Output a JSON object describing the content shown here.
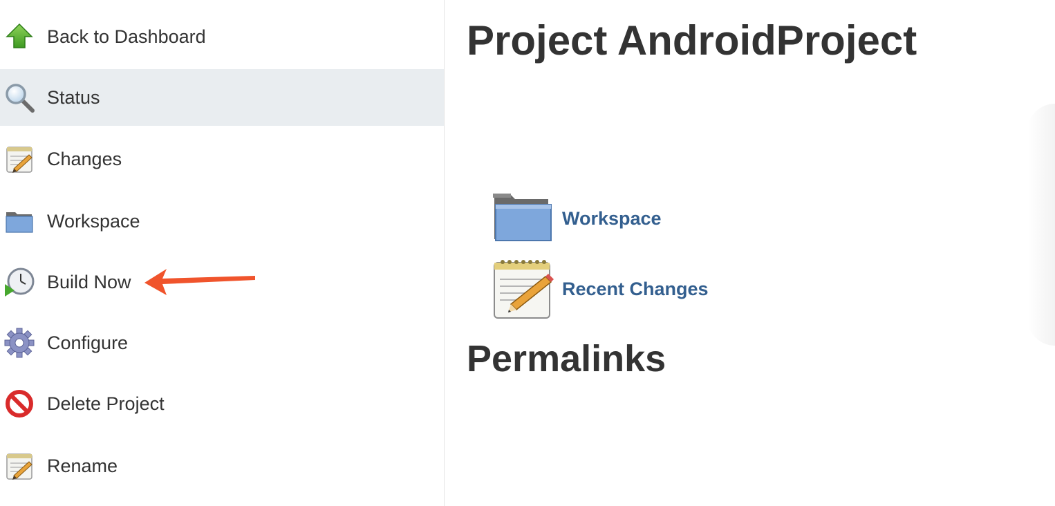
{
  "sidebar": {
    "items": [
      {
        "label": "Back to Dashboard",
        "icon": "up-arrow-icon"
      },
      {
        "label": "Status",
        "icon": "magnifier-icon"
      },
      {
        "label": "Changes",
        "icon": "notepad-icon"
      },
      {
        "label": "Workspace",
        "icon": "folder-icon"
      },
      {
        "label": "Build Now",
        "icon": "clock-play-icon"
      },
      {
        "label": "Configure",
        "icon": "gear-icon"
      },
      {
        "label": "Delete Project",
        "icon": "no-entry-icon"
      },
      {
        "label": "Rename",
        "icon": "notepad-icon"
      }
    ],
    "active_item": "Status"
  },
  "main": {
    "title": "Project AndroidProject",
    "links": [
      {
        "label": "Workspace",
        "icon": "folder-icon"
      },
      {
        "label": "Recent Changes",
        "icon": "notepad-icon"
      }
    ],
    "permalinks_heading": "Permalinks"
  },
  "annotation": {
    "type": "arrow",
    "points_to": "Build Now",
    "color": "#f0542c"
  },
  "colors": {
    "link": "#335f8f",
    "text": "#333333",
    "active_bg": "#e9edf0"
  }
}
